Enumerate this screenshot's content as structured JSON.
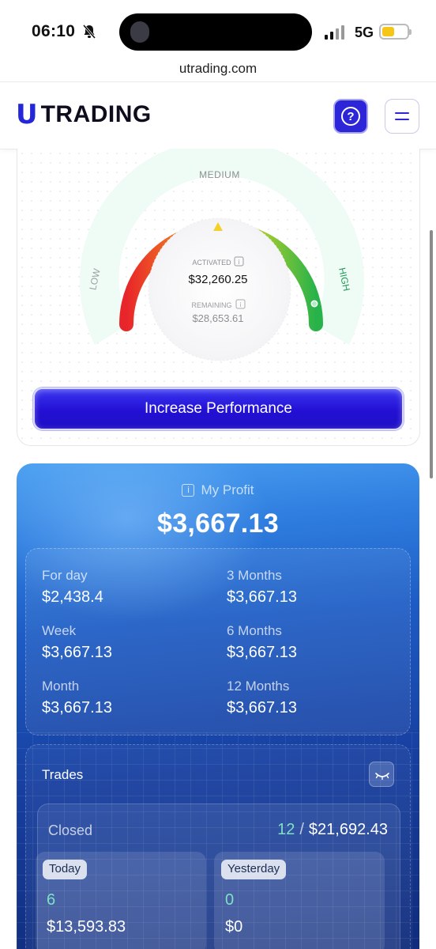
{
  "status_bar": {
    "time": "06:10",
    "network": "5G"
  },
  "browser": {
    "url": "utrading.com"
  },
  "header": {
    "logo_mark": "U",
    "logo_text": "TRADING",
    "help_icon": "question-icon",
    "menu_icon": "hamburger-icon"
  },
  "gauge": {
    "label_low": "LOW",
    "label_medium": "MEDIUM",
    "label_high": "HIGH",
    "activated_label": "ACTIVATED",
    "activated_value": "$32,260.25",
    "remaining_label": "REMAINING",
    "remaining_value": "$28,653.61",
    "level_fraction": 1.0,
    "colors": {
      "low": "#e8252a",
      "mid": "#f2d12a",
      "high": "#27b24a",
      "track": "#eefbf4"
    }
  },
  "increase_button": {
    "label": "Increase Performance"
  },
  "profit": {
    "title": "My Profit",
    "total": "$3,667.13",
    "periods": [
      {
        "label": "For day",
        "value": "$2,438.4"
      },
      {
        "label": "3 Months",
        "value": "$3,667.13"
      },
      {
        "label": "Week",
        "value": "$3,667.13"
      },
      {
        "label": "6 Months",
        "value": "$3,667.13"
      },
      {
        "label": "Month",
        "value": "$3,667.13"
      },
      {
        "label": "12 Months",
        "value": "$3,667.13"
      }
    ]
  },
  "trades": {
    "title": "Trades",
    "toggle_icon": "eye-closed-icon",
    "closed_label": "Closed",
    "closed_count": "12",
    "closed_separator": "/",
    "closed_amount": "$21,692.43",
    "today": {
      "label": "Today",
      "count": "6",
      "amount": "$13,593.83"
    },
    "yesterday": {
      "label": "Yesterday",
      "count": "0",
      "amount": "$0"
    }
  }
}
